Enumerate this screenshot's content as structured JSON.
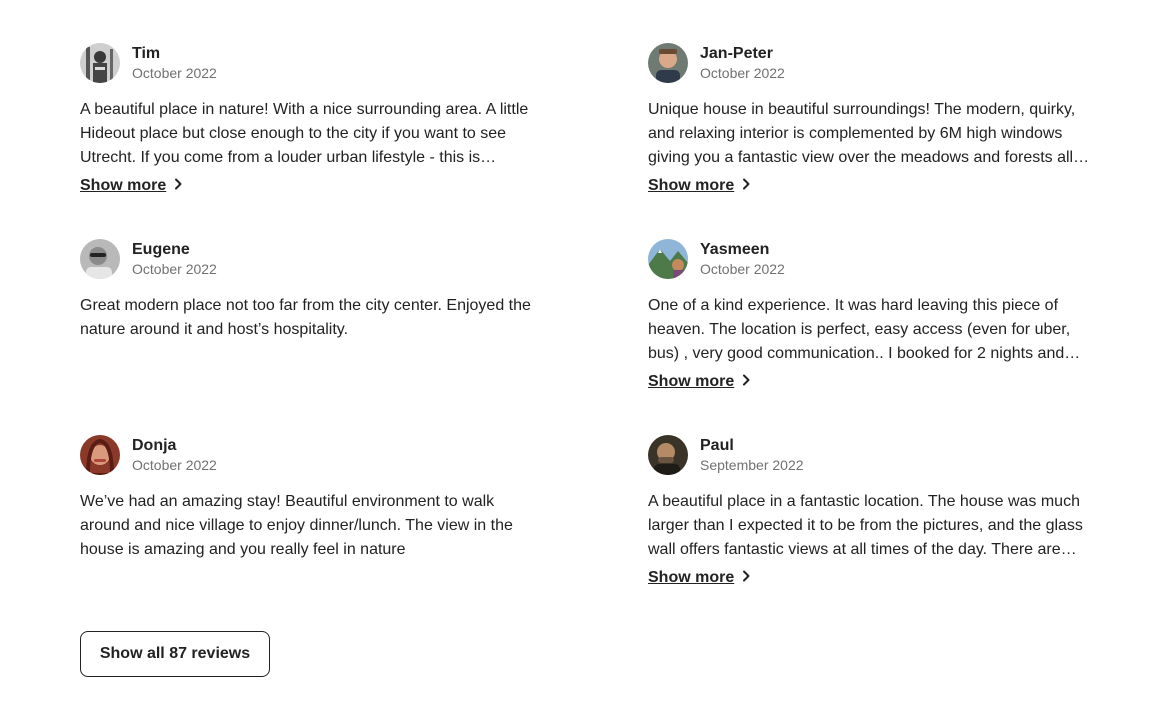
{
  "reviews": [
    {
      "name": "Tim",
      "date": "October 2022",
      "text": "A beautiful place in nature! With a nice surrounding area. A little Hideout place but close enough to the city if you want to see Utrecht. If you come from a louder urban lifestyle - this is…",
      "show_more": "Show more"
    },
    {
      "name": "Jan-Peter",
      "date": "October 2022",
      "text": "Unique house in beautiful surroundings! The modern, quirky, and relaxing interior is complemented by 6M high windows giving you a fantastic view over the meadows and forests all…",
      "show_more": "Show more"
    },
    {
      "name": "Eugene",
      "date": "October 2022",
      "text": "Great modern place not too far from the city center. Enjoyed the nature around it and host’s hospitality.",
      "show_more": ""
    },
    {
      "name": "Yasmeen",
      "date": "October 2022",
      "text": "One of a kind experience. It was hard leaving this piece of heaven. The location is perfect, easy access (even for uber, bus) , very good communication.. I booked for 2 nights and…",
      "show_more": "Show more"
    },
    {
      "name": "Donja",
      "date": "October 2022",
      "text": "We’ve had an amazing stay! Beautiful environment to walk around and nice village to enjoy dinner/lunch. The view in the house is amazing and you really feel in nature",
      "show_more": ""
    },
    {
      "name": "Paul",
      "date": "September 2022",
      "text": "A beautiful place in a fantastic location. The house was much larger than I expected it to be from the pictures, and the glass wall offers fantastic views at all times of the day. There are…",
      "show_more": "Show more"
    }
  ],
  "show_all_button": "Show all 87 reviews"
}
